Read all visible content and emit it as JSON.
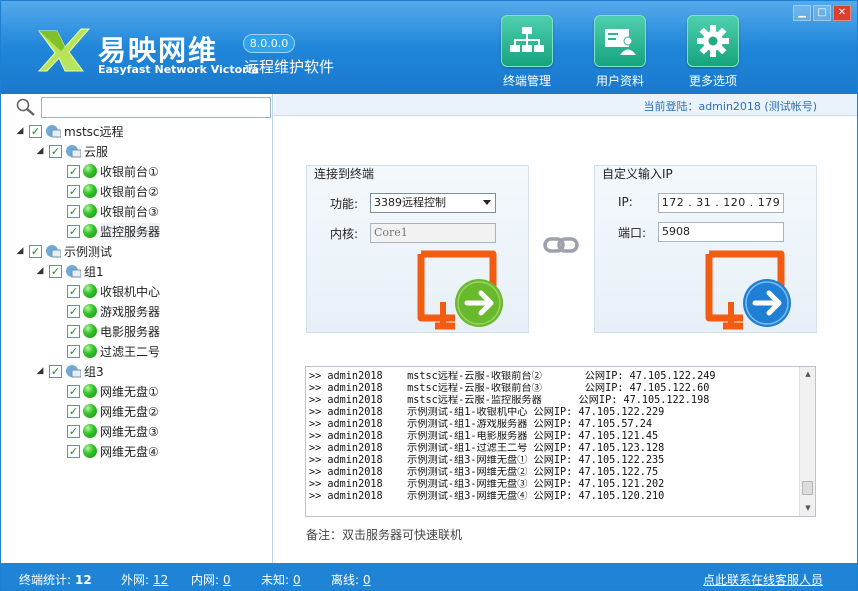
{
  "app": {
    "brand_cn": "易映网维",
    "brand_en": "Easyfast Network Victoria",
    "version": "8.0.0.0",
    "subtitle": "远程维护软件",
    "colors": {
      "header": "#1f85d8",
      "accent_green": "#16a37e",
      "status_bar": "#1f84d6",
      "link_blue": "#2e6fb6"
    }
  },
  "window_controls": {
    "minimize": "▁",
    "maximize": "□",
    "close": "✕"
  },
  "nav": [
    {
      "label": "终端管理",
      "icon": "network-tree-icon"
    },
    {
      "label": "用户资料",
      "icon": "user-card-icon"
    },
    {
      "label": "更多选项",
      "icon": "gear-icon"
    }
  ],
  "search": {
    "value": "",
    "placeholder": ""
  },
  "tree": [
    {
      "label": "mstsc远程",
      "level": 0,
      "kind": "root",
      "expanded": true,
      "checked": true
    },
    {
      "label": "云服",
      "level": 1,
      "kind": "group",
      "expanded": true,
      "checked": true
    },
    {
      "label": "收银前台①",
      "level": 2,
      "kind": "host",
      "checked": true
    },
    {
      "label": "收银前台②",
      "level": 2,
      "kind": "host",
      "checked": true
    },
    {
      "label": "收银前台③",
      "level": 2,
      "kind": "host",
      "checked": true
    },
    {
      "label": "监控服务器",
      "level": 2,
      "kind": "host",
      "checked": true,
      "selected": true
    },
    {
      "label": "示例测试",
      "level": 0,
      "kind": "root",
      "expanded": true,
      "checked": true
    },
    {
      "label": "组1",
      "level": 1,
      "kind": "group",
      "expanded": true,
      "checked": true
    },
    {
      "label": "收银机中心",
      "level": 2,
      "kind": "host",
      "checked": true
    },
    {
      "label": "游戏服务器",
      "level": 2,
      "kind": "host",
      "checked": true
    },
    {
      "label": "电影服务器",
      "level": 2,
      "kind": "host",
      "checked": true
    },
    {
      "label": "过滤王二号",
      "level": 2,
      "kind": "host",
      "checked": true
    },
    {
      "label": "组3",
      "level": 1,
      "kind": "group",
      "expanded": true,
      "checked": true
    },
    {
      "label": "网维无盘①",
      "level": 2,
      "kind": "host",
      "checked": true
    },
    {
      "label": "网维无盘②",
      "level": 2,
      "kind": "host",
      "checked": true
    },
    {
      "label": "网维无盘③",
      "level": 2,
      "kind": "host",
      "checked": true
    },
    {
      "label": "网维无盘④",
      "level": 2,
      "kind": "host",
      "checked": true
    }
  ],
  "user_bar": {
    "text": "当前登陆：admin2018 (测试帐号)"
  },
  "connect_terminal": {
    "title": "连接到终端",
    "func_label": "功能:",
    "func_value": "3389远程控制",
    "core_label": "内核:",
    "core_value": "Core1"
  },
  "custom_ip": {
    "title": "自定义输入IP",
    "ip_label": "IP:",
    "ip_value": "172 . 31 . 120 . 179",
    "port_label": "端口:",
    "port_value": "5908"
  },
  "log": [
    ">> admin2018    mstsc远程-云服-收银前台②       公网IP: 47.105.122.249",
    ">> admin2018    mstsc远程-云服-收银前台③       公网IP: 47.105.122.60",
    ">> admin2018    mstsc远程-云服-监控服务器      公网IP: 47.105.122.198",
    ">> admin2018    示例测试-组1-收银机中心 公网IP: 47.105.122.229",
    ">> admin2018    示例测试-组1-游戏服务器 公网IP: 47.105.57.24",
    ">> admin2018    示例测试-组1-电影服务器 公网IP: 47.105.121.45",
    ">> admin2018    示例测试-组1-过滤王二号 公网IP: 47.105.123.128",
    ">> admin2018    示例测试-组3-网维无盘① 公网IP: 47.105.122.235",
    ">> admin2018    示例测试-组3-网维无盘② 公网IP: 47.105.122.75",
    ">> admin2018    示例测试-组3-网维无盘③ 公网IP: 47.105.121.202",
    ">> admin2018    示例测试-组3-网维无盘④ 公网IP: 47.105.120.210"
  ],
  "note": "备注：双击服务器可快速联机",
  "status": {
    "total_label": "终端统计:",
    "total_value": "12",
    "wan_label": "外网:",
    "wan_value": "12",
    "lan_label": "内网:",
    "lan_value": "0",
    "unknown_label": "未知:",
    "unknown_value": "0",
    "offline_label": "离线:",
    "offline_value": "0",
    "support_link": "点此联系在线客服人员"
  }
}
